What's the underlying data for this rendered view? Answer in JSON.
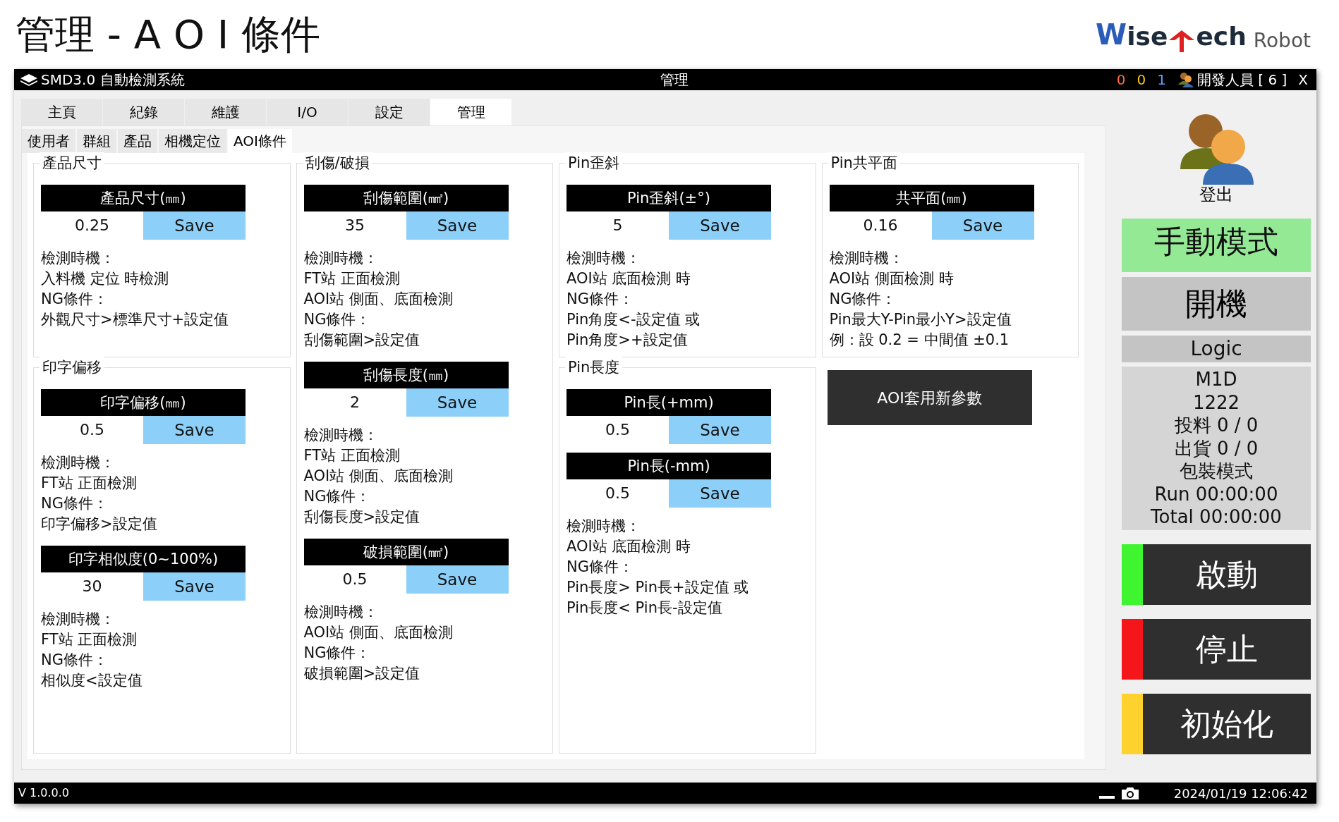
{
  "page_title": "管理 - A O I 條件",
  "logo": {
    "initial": "W",
    "part_1": "ise",
    "part_2": "ech",
    "suffix": "Robot"
  },
  "title_bar": {
    "app_name": "SMD3.0 自動檢測系統",
    "title": "管理",
    "counters": [
      {
        "value": "0",
        "color": "#ff6a3d"
      },
      {
        "value": "0",
        "color": "#f5c400"
      },
      {
        "value": "1",
        "color": "#5aa0ff"
      }
    ],
    "user": "開發人員 [ 6 ]",
    "close": "X"
  },
  "tabs": [
    {
      "label": "主頁",
      "selected": false
    },
    {
      "label": "紀錄",
      "selected": false
    },
    {
      "label": "維護",
      "selected": false
    },
    {
      "label": "I/O",
      "selected": false
    },
    {
      "label": "設定",
      "selected": false
    },
    {
      "label": "管理",
      "selected": true
    }
  ],
  "sub_tabs": [
    {
      "label": "使用者",
      "selected": false
    },
    {
      "label": "群組",
      "selected": false
    },
    {
      "label": "產品",
      "selected": false
    },
    {
      "label": "相機定位",
      "selected": false
    },
    {
      "label": "AOI條件",
      "selected": true
    }
  ],
  "columns": [
    {
      "items": [
        {
          "kind": "frame",
          "legend": "產品尺寸",
          "blocks": [
            {
              "params": [
                {
                  "label": "產品尺寸(㎜)",
                  "value": "0.25",
                  "button": "Save"
                }
              ],
              "notes": [
                "檢測時機：",
                "入料機 定位 時檢測",
                "NG條件：",
                "外觀尺寸>標準尺寸+設定值"
              ]
            }
          ]
        },
        {
          "kind": "frame",
          "legend": "印字偏移",
          "blocks": [
            {
              "params": [
                {
                  "label": "印字偏移(㎜)",
                  "value": "0.5",
                  "button": "Save"
                }
              ],
              "notes": [
                "檢測時機：",
                "FT站 正面檢測",
                "NG條件：",
                "印字偏移>設定值"
              ]
            },
            {
              "params": [
                {
                  "label": "印字相似度(0~100%)",
                  "value": "30",
                  "button": "Save"
                }
              ],
              "notes": [
                "檢測時機：",
                "FT站 正面檢測",
                "NG條件：",
                "相似度<設定值"
              ]
            }
          ]
        }
      ]
    },
    {
      "items": [
        {
          "kind": "frame",
          "legend": "刮傷/破損",
          "blocks": [
            {
              "params": [
                {
                  "label": "刮傷範圍(㎟)",
                  "value": "35",
                  "button": "Save"
                }
              ],
              "notes": [
                "檢測時機：",
                "FT站 正面檢測",
                "AOI站 側面、底面檢測",
                "NG條件：",
                "刮傷範圍>設定值"
              ]
            },
            {
              "params": [
                {
                  "label": "刮傷長度(㎜)",
                  "value": "2",
                  "button": "Save"
                }
              ],
              "notes": [
                "檢測時機：",
                "FT站 正面檢測",
                "AOI站 側面、底面檢測",
                "NG條件：",
                "刮傷長度>設定值"
              ]
            },
            {
              "params": [
                {
                  "label": "破損範圍(㎟)",
                  "value": "0.5",
                  "button": "Save"
                }
              ],
              "notes": [
                "檢測時機：",
                "AOI站 側面、底面檢測",
                "NG條件：",
                "破損範圍>設定值"
              ]
            }
          ]
        }
      ]
    },
    {
      "items": [
        {
          "kind": "frame",
          "legend": "Pin歪斜",
          "blocks": [
            {
              "params": [
                {
                  "label": "Pin歪斜(±°)",
                  "value": "5",
                  "button": "Save"
                }
              ],
              "notes": [
                "檢測時機：",
                "AOI站 底面檢測 時",
                "NG條件：",
                "Pin角度<-設定值 或",
                "Pin角度>+設定值"
              ]
            }
          ]
        },
        {
          "kind": "frame",
          "legend": "Pin長度",
          "blocks": [
            {
              "params": [
                {
                  "label": "Pin長(+mm)",
                  "value": "0.5",
                  "button": "Save"
                },
                {
                  "label": "Pin長(-mm)",
                  "value": "0.5",
                  "button": "Save"
                }
              ],
              "notes": [
                "檢測時機：",
                "AOI站 底面檢測 時",
                "NG條件：",
                "Pin長度> Pin長+設定值 或",
                "Pin長度< Pin長-設定值"
              ]
            }
          ]
        }
      ]
    },
    {
      "items": [
        {
          "kind": "frame",
          "legend": "Pin共平面",
          "blocks": [
            {
              "params": [
                {
                  "label": "共平面(㎜)",
                  "value": "0.16",
                  "button": "Save"
                }
              ],
              "notes": [
                "檢測時機：",
                "AOI站 側面檢測 時",
                "NG條件：",
                "Pin最大Y-Pin最小Y>設定值",
                "例：設 0.2 = 中間值 ±0.1"
              ]
            }
          ]
        },
        {
          "kind": "button",
          "label": "AOI套用新參數"
        }
      ]
    }
  ],
  "sidebar": {
    "logout": "登出",
    "mode": "手動模式",
    "power": "開機",
    "logic": "Logic",
    "info": [
      "M1D",
      "1222",
      "投料 0 / 0",
      "出貨 0 / 0",
      "包裝模式",
      "Run 00:00:00",
      "Total 00:00:00"
    ],
    "actions": [
      {
        "label": "啟動",
        "color": "#3ef52f"
      },
      {
        "label": "停止",
        "color": "#f5161c"
      },
      {
        "label": "初始化",
        "color": "#fdd22f"
      }
    ]
  },
  "status_bar": {
    "version": "V 1.0.0.0",
    "datetime": "2024/01/19 12:06:42"
  }
}
